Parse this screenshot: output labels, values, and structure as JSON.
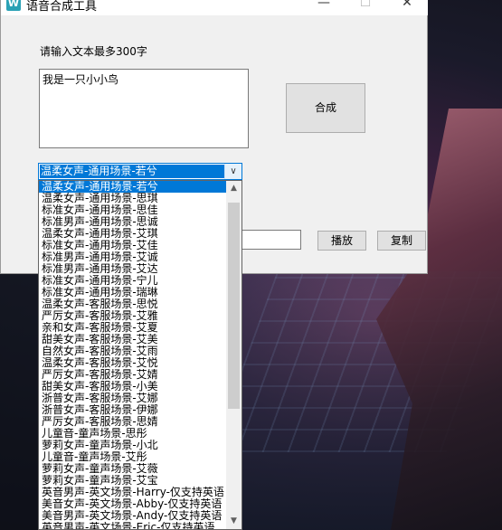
{
  "window": {
    "title": "语音合成工具",
    "prompt": "请输入文本最多300字",
    "input_text": "我是一只小小鸟",
    "synth_button": "合成",
    "play_button": "播放",
    "copy_button": "复制",
    "controls": {
      "minimize": "—",
      "maximize": "☐",
      "close": "✕"
    }
  },
  "voice_select": {
    "selected": "温柔女声-通用场景-若兮",
    "options": [
      "温柔女声-通用场景-若兮",
      "温柔女声-通用场景-思琪",
      "标准女声-通用场景-思佳",
      "标准男声-通用场景-思诚",
      "温柔女声-通用场景-艾琪",
      "标准女声-通用场景-艾佳",
      "标准男声-通用场景-艾诚",
      "标准男声-通用场景-艾达",
      "标准女声-通用场景-宁儿",
      "标准女声-通用场景-瑞琳",
      "温柔女声-客服场景-思悦",
      "严厉女声-客服场景-艾雅",
      "亲和女声-客服场景-艾夏",
      "甜美女声-客服场景-艾美",
      "自然女声-客服场景-艾雨",
      "温柔女声-客服场景-艾悦",
      "严厉女声-客服场景-艾婧",
      "甜美女声-客服场景-小美",
      "浙普女声-客服场景-艾娜",
      "浙普女声-客服场景-伊娜",
      "严厉女声-客服场景-思婧",
      "儿童音-童声场景-思彤",
      "萝莉女声-童声场景-小北",
      "儿童音-童声场景-艾彤",
      "萝莉女声-童声场景-艾薇",
      "萝莉女声-童声场景-艾宝",
      "英音男声-英文场景-Harry-仅支持英语",
      "美音女声-英文场景-Abby-仅支持英语",
      "美音男声-英文场景-Andy-仅支持英语",
      "英音男声-英文场景-Eric-仅支持英语"
    ]
  }
}
